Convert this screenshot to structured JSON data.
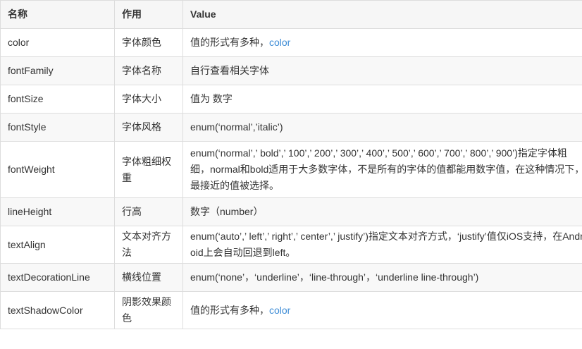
{
  "table": {
    "headers": [
      "名称",
      "作用",
      "Value"
    ],
    "rows": [
      {
        "name": "color",
        "purpose": "字体颜色",
        "value_text": "值的形式有多种，",
        "value_link": "color"
      },
      {
        "name": "fontFamily",
        "purpose": "字体名称",
        "value_text": "自行查看相关字体"
      },
      {
        "name": "fontSize",
        "purpose": "字体大小",
        "value_text": "值为 数字"
      },
      {
        "name": "fontStyle",
        "purpose": "字体风格",
        "value_text": "enum(‘normal’,’italic’)"
      },
      {
        "name": "fontWeight",
        "purpose": "字体粗细权重",
        "value_text": "enum(‘normal’,’ bold’,’ 100’,’ 200’,’ 300’,’ 400’,’ 500’,’ 600’,’ 700’,’ 800’,’ 900’)指定字体粗细，normal和bold适用于大多数字体，不是所有的字体的值都能用数字值，在这种情况下，最接近的值被选择。"
      },
      {
        "name": "lineHeight",
        "purpose": "行高",
        "value_text": "数字（number）"
      },
      {
        "name": "textAlign",
        "purpose": "文本对齐方法",
        "value_text": "enum(‘auto’,’ left’,’ right’,’ center’,’ justify’)指定文本对齐方式，‘justify’值仅iOS支持，在Android上会自动回退到left。"
      },
      {
        "name": "textDecorationLine",
        "purpose": "横线位置",
        "value_text": "enum(‘none’，‘underline’，‘line-through’，‘underline line-through’)"
      },
      {
        "name": "textShadowColor",
        "purpose": "阴影效果颜色",
        "value_text": "值的形式有多种，",
        "value_link": "color"
      }
    ]
  }
}
